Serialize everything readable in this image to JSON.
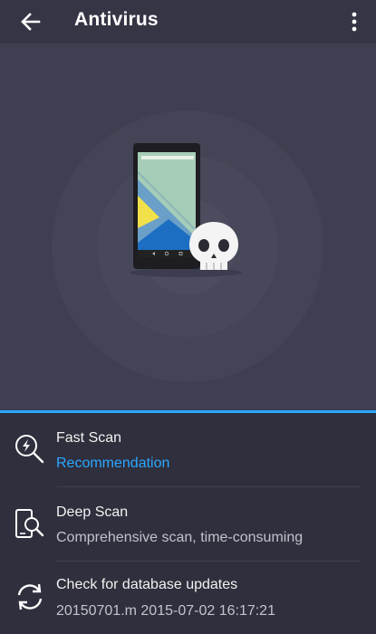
{
  "header": {
    "title": "Antivirus",
    "back_icon": "back-arrow-icon",
    "menu_icon": "more-vert-icon"
  },
  "hero": {
    "illustration": "phone-with-skull"
  },
  "colors": {
    "accent": "#2ba7ff",
    "background": "#2f2f3d",
    "hero_background": "#3e3f50",
    "topbar": "#353545"
  },
  "scan_options": [
    {
      "title": "Fast Scan",
      "subtitle": "Recommendation",
      "icon": "fast-scan-icon"
    },
    {
      "title": "Deep Scan",
      "subtitle": "Comprehensive scan, time-consuming",
      "icon": "deep-scan-icon"
    },
    {
      "title": "Check for database updates",
      "subtitle": "20150701.m  2015-07-02 16:17:21",
      "icon": "refresh-icon"
    }
  ]
}
